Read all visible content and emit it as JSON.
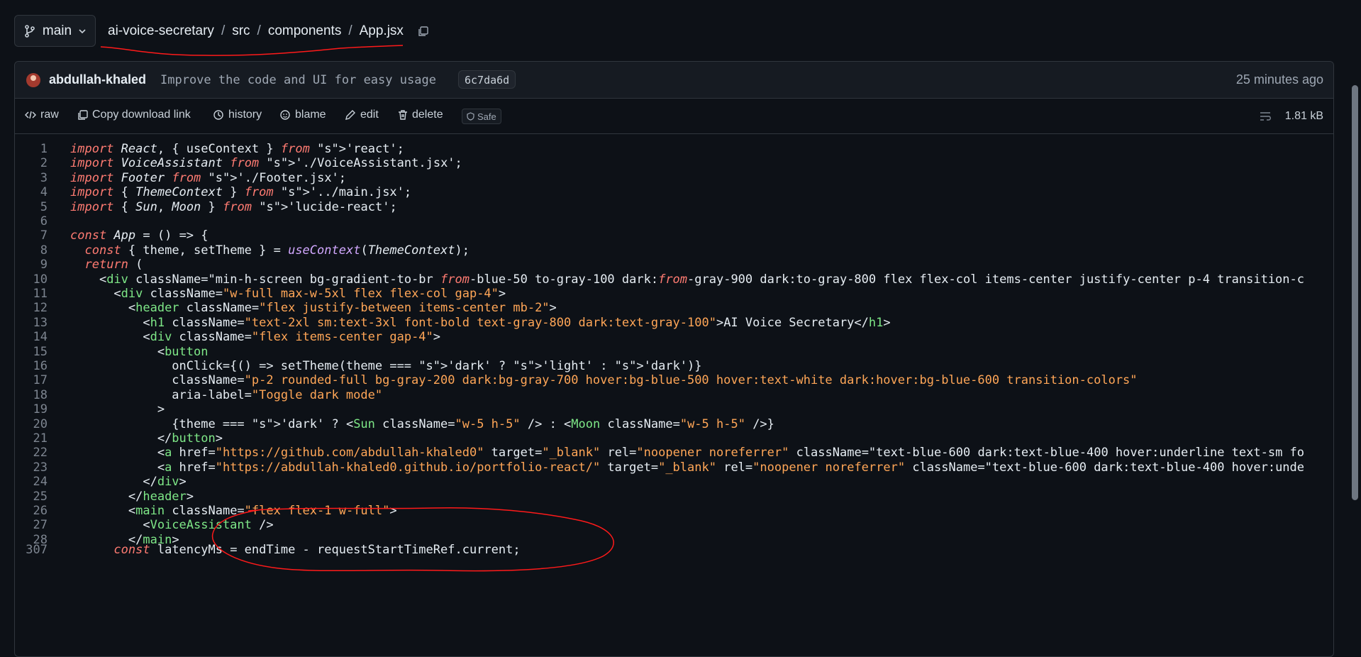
{
  "header": {
    "branch": "main",
    "breadcrumb": [
      "ai-voice-secretary",
      "src",
      "components",
      "App.jsx"
    ],
    "sep": "/"
  },
  "commit": {
    "author": "abdullah-khaled",
    "message": "Improve the code and UI for easy usage",
    "sha": "6c7da6d",
    "time": "25 minutes ago"
  },
  "toolbar": {
    "raw": "raw",
    "copy_download": "Copy download link",
    "history": "history",
    "blame": "blame",
    "edit": "edit",
    "delete": "delete",
    "safe": "Safe",
    "size": "1.81 kB"
  },
  "code_lines": [
    {
      "n": "1",
      "t": "import React, { useContext } from 'react';"
    },
    {
      "n": "2",
      "t": "import VoiceAssistant from './VoiceAssistant.jsx';"
    },
    {
      "n": "3",
      "t": "import Footer from './Footer.jsx';"
    },
    {
      "n": "4",
      "t": "import { ThemeContext } from '../main.jsx';"
    },
    {
      "n": "5",
      "t": "import { Sun, Moon } from 'lucide-react';"
    },
    {
      "n": "6",
      "t": ""
    },
    {
      "n": "7",
      "t": "const App = () => {"
    },
    {
      "n": "8",
      "t": "  const { theme, setTheme } = useContext(ThemeContext);"
    },
    {
      "n": "9",
      "t": "  return ("
    },
    {
      "n": "10",
      "t": "    <div className=\"min-h-screen bg-gradient-to-br from-blue-50 to-gray-100 dark:from-gray-900 dark:to-gray-800 flex flex-col items-center justify-center p-4 transition-c"
    },
    {
      "n": "11",
      "t": "      <div className=\"w-full max-w-5xl flex flex-col gap-4\">"
    },
    {
      "n": "12",
      "t": "        <header className=\"flex justify-between items-center mb-2\">"
    },
    {
      "n": "13",
      "t": "          <h1 className=\"text-2xl sm:text-3xl font-bold text-gray-800 dark:text-gray-100\">AI Voice Secretary</h1>"
    },
    {
      "n": "14",
      "t": "          <div className=\"flex items-center gap-4\">"
    },
    {
      "n": "15",
      "t": "            <button"
    },
    {
      "n": "16",
      "t": "              onClick={() => setTheme(theme === 'dark' ? 'light' : 'dark')}"
    },
    {
      "n": "17",
      "t": "              className=\"p-2 rounded-full bg-gray-200 dark:bg-gray-700 hover:bg-blue-500 hover:text-white dark:hover:bg-blue-600 transition-colors\""
    },
    {
      "n": "18",
      "t": "              aria-label=\"Toggle dark mode\""
    },
    {
      "n": "19",
      "t": "            >"
    },
    {
      "n": "20",
      "t": "              {theme === 'dark' ? <Sun className=\"w-5 h-5\" /> : <Moon className=\"w-5 h-5\" />}"
    },
    {
      "n": "21",
      "t": "            </button>"
    },
    {
      "n": "22",
      "t": "            <a href=\"https://github.com/abdullah-khaled0\" target=\"_blank\" rel=\"noopener noreferrer\" className=\"text-blue-600 dark:text-blue-400 hover:underline text-sm fo"
    },
    {
      "n": "23",
      "t": "            <a href=\"https://abdullah-khaled0.github.io/portfolio-react/\" target=\"_blank\" rel=\"noopener noreferrer\" className=\"text-blue-600 dark:text-blue-400 hover:unde"
    },
    {
      "n": "24",
      "t": "          </div>"
    },
    {
      "n": "25",
      "t": "        </header>"
    },
    {
      "n": "26",
      "t": "        <main className=\"flex flex-1 w-full\">"
    },
    {
      "n": "27",
      "t": "          <VoiceAssistant />"
    },
    {
      "n": "28",
      "t": "        </main>"
    },
    {
      "n": "307",
      "t": "      const latencyMs = endTime - requestStartTimeRef.current;"
    }
  ],
  "colors": {
    "background": "#0d1117",
    "panel": "#161b22",
    "border": "#30363d",
    "annotation": "#ff1a1a"
  }
}
